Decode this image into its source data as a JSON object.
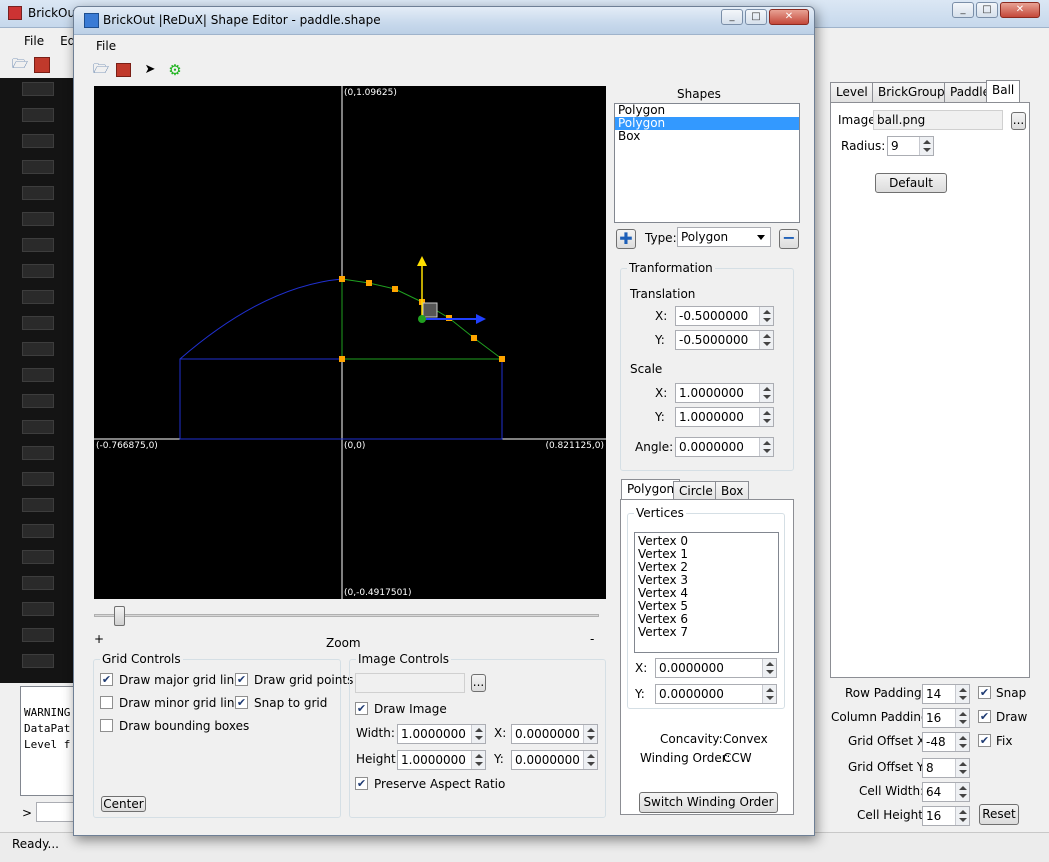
{
  "main": {
    "title": "BrickOut",
    "menu": [
      "File",
      "Ed"
    ],
    "console_lines": [
      "WARNING",
      "DataPat",
      "Level f"
    ],
    "prompt": ">",
    "status": "Ready...",
    "right_tabs": [
      "Level",
      "BrickGroups",
      "Paddle",
      "Ball"
    ],
    "ball": {
      "image_label": "Image:",
      "image_value": "ball.png",
      "browse": "...",
      "radius_label": "Radius:",
      "radius_value": "9",
      "default_button": "Default"
    },
    "grid_settings": [
      {
        "label": "Row Padding:",
        "value": "14",
        "check": "Snap"
      },
      {
        "label": "Column Padding:",
        "value": "16",
        "check": "Draw"
      },
      {
        "label": "Grid Offset X:",
        "value": "-48",
        "check": "Fix"
      },
      {
        "label": "Grid Offset Y:",
        "value": "8"
      },
      {
        "label": "Cell Width:",
        "value": "64"
      },
      {
        "label": "Cell Height:",
        "value": "16"
      }
    ],
    "reset_button": "Reset"
  },
  "editor": {
    "title": "BrickOut |ReDuX| Shape Editor - paddle.shape",
    "menu": [
      "File"
    ],
    "canvas_labels": {
      "top": "(0,1.09625)",
      "left": "(-0.766875,0)",
      "origin": "(0,0)",
      "right": "(0.821125,0)",
      "bottom": "(0,-0.4917501)"
    },
    "zoom": {
      "label": "Zoom",
      "plus": "+",
      "minus": "-",
      "level": 0.04
    },
    "grid_controls": {
      "title": "Grid Controls",
      "major": "Draw major grid lines",
      "points": "Draw grid points",
      "minor": "Draw minor grid lines",
      "snap": "Snap to grid",
      "bbox": "Draw bounding boxes",
      "center_button": "Center"
    },
    "image_controls": {
      "title": "Image Controls",
      "browse": "...",
      "draw_image": "Draw Image",
      "width_label": "Width:",
      "width_value": "1.0000000",
      "x_label": "X:",
      "x_value": "0.0000000",
      "height_label": "Height:",
      "height_value": "1.0000000",
      "y_label": "Y:",
      "y_value": "0.0000000",
      "preserve": "Preserve Aspect Ratio"
    },
    "shapes": {
      "title": "Shapes",
      "items": [
        "Polygon",
        "Polygon",
        "Box"
      ],
      "type_label": "Type:",
      "type_value": "Polygon"
    },
    "transformation": {
      "title": "Tranformation",
      "translation": "Translation",
      "tx_label": "X:",
      "tx_value": "-0.5000000",
      "ty_label": "Y:",
      "ty_value": "-0.5000000",
      "scale": "Scale",
      "sx_label": "X:",
      "sx_value": "1.0000000",
      "sy_label": "Y:",
      "sy_value": "1.0000000",
      "angle_label": "Angle:",
      "angle_value": "0.0000000"
    },
    "shape_tabs": [
      "Polygon",
      "Circle",
      "Box"
    ],
    "vertices": {
      "title": "Vertices",
      "items": [
        "Vertex 0",
        "Vertex 1",
        "Vertex 2",
        "Vertex 3",
        "Vertex 4",
        "Vertex 5",
        "Vertex 6",
        "Vertex 7"
      ],
      "x_label": "X:",
      "x_value": "0.0000000",
      "y_label": "Y:",
      "y_value": "0.0000000",
      "concavity_label": "Concavity:",
      "concavity_value": "Convex",
      "winding_label": "Winding Order:",
      "winding_value": "CCW",
      "switch_button": "Switch Winding Order"
    }
  }
}
